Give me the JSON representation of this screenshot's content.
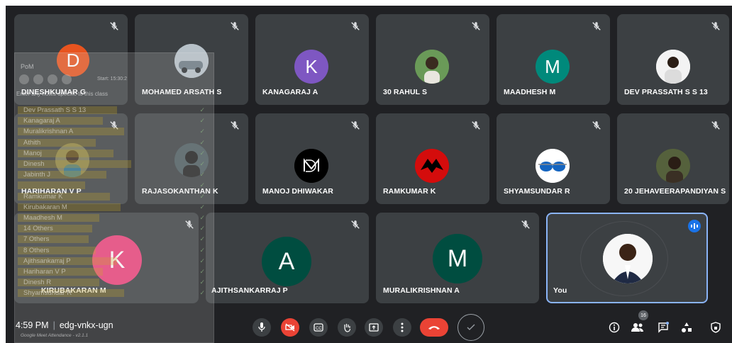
{
  "participants": {
    "dineshkumar": "DINESHKUMAR G",
    "arsath": "MOHAMED ARSATH S",
    "kanagaraj": "KANAGARAJ A",
    "rahul": "30 RAHUL S",
    "maadhesh": "MAADHESH M",
    "devprassath": "DEV PRASSATH S S 13",
    "hariharan": "HARIHARAN V P",
    "rajasokanthan": "RAJASOKANTHAN K",
    "manoj": "MANOJ DHIWAKAR",
    "ramkumar": "RAMKUMAR K",
    "shyamsundar": "SHYAMSUNDAR R",
    "jehaveera": "20 JEHAVEERAPANDIYAN S",
    "kirubakaran": "KIRUBAKARAN M",
    "ajithsankarraj": "AJITHSANKARRAJ P",
    "muralikrishnan": "MURALIKRISHNAN A",
    "self": "You"
  },
  "initials": {
    "dineshkumar": "D",
    "kanagaraj": "K",
    "maadhesh": "M",
    "kirubakaran": "K",
    "ajithsankarraj": "A",
    "muralikrishnan": "M"
  },
  "colors": {
    "dineshkumar": "#e8541f",
    "kanagaraj": "#7e57c2",
    "maadhesh": "#00897b",
    "kirubakaran": "#ec407a",
    "ajithsankarraj": "#004d40",
    "muralikrishnan": "#004d40",
    "accent": "#8ab4f8",
    "danger": "#ea4335"
  },
  "extension": {
    "title": "PoM",
    "start_label": "Start: 15:30:2",
    "notes_placeholder": "Enter any notes specific to this class",
    "rows": [
      "Dev Prassath S S 13",
      "Kanagaraj A",
      "Muralikrishnan A",
      "Athith",
      "Manoj",
      "Dinesh",
      "Jabinth J",
      "",
      "Ramkumar K",
      "Kirubakaran M",
      "Maadhesh M",
      "14 Others",
      "7 Others",
      "8 Others",
      "Ajithsankarraj P",
      "Hariharan V P",
      "Dinesh R",
      "Shyamsundar R"
    ],
    "credit": "Google Meet Attendance - v2.1.1"
  },
  "meeting": {
    "time": "4:59 PM",
    "code": "edg-vnkx-ugn",
    "participant_count": "16"
  },
  "icons": {
    "mute": "mic-off-icon",
    "speaking": "speaking-indicator-icon",
    "mic": "mic-icon",
    "camera_off": "videocam-off-icon",
    "captions": "closed-captions-icon",
    "raise_hand": "raise-hand-icon",
    "present": "present-screen-icon",
    "more": "more-options-icon",
    "hangup": "call-end-icon",
    "info": "info-icon",
    "people": "people-icon",
    "chat": "chat-icon",
    "activities": "activities-icon",
    "host": "host-controls-icon"
  }
}
